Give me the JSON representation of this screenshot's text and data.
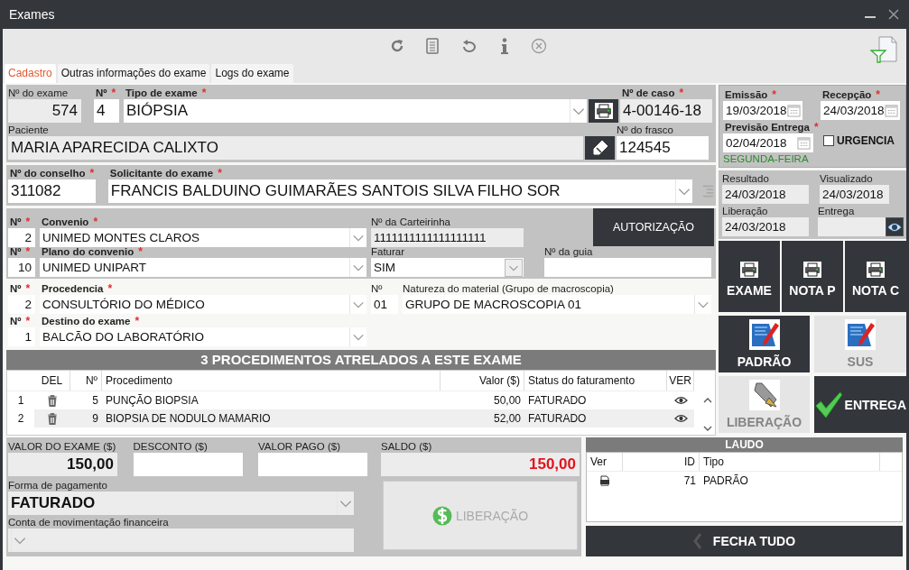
{
  "window": {
    "title": "Exames"
  },
  "tabs": [
    {
      "label": "Cadastro",
      "selected": true
    },
    {
      "label": "Outras informações do exame",
      "selected": false
    },
    {
      "label": "Logs do exame",
      "selected": false
    }
  ],
  "exam": {
    "exam_number": {
      "label": "Nº do exame",
      "value": "574",
      "readonly": true
    },
    "type_number": {
      "label": "Nº",
      "mark": "*",
      "value": "4",
      "readonly": false
    },
    "exam_type": {
      "label": "Tipo de exame",
      "mark": "*",
      "value": "BIÓPSIA",
      "readonly": false
    },
    "case_number": {
      "label": "Nº de caso",
      "mark": "*",
      "value": "4-00146-18",
      "readonly": true
    },
    "patient": {
      "label": "Paciente",
      "value": "MARIA APARECIDA CALIXTO",
      "readonly": true
    },
    "flask_number": {
      "label": "Nº do frasco",
      "value": "124545",
      "readonly": false
    },
    "council_number": {
      "label": "Nº do conselho",
      "mark": "*",
      "value": "311082",
      "readonly": false
    },
    "requester": {
      "label": "Solicitante do exame",
      "mark": "*",
      "value": "FRANCIS BALDUINO GUIMARÃES SANTOIS SILVA FILHO SOR",
      "readonly": false
    }
  },
  "insurance": {
    "insurer_number": {
      "label": "Nº",
      "mark": "*",
      "value": "2",
      "readonly": false
    },
    "insurer": {
      "label": "Convenio",
      "mark": "*",
      "value": "UNIMED MONTES CLAROS",
      "readonly": false
    },
    "card_number": {
      "label": "Nº da Carteirinha",
      "value": "1111111111111111111",
      "readonly": true
    },
    "authorization_button": "AUTORIZAÇÃO",
    "plan_number": {
      "label": "Nº",
      "mark": "*",
      "value": "10",
      "readonly": false
    },
    "plan": {
      "label": "Plano do convenio",
      "mark": "*",
      "value": "UNIMED UNIPART",
      "readonly": false
    },
    "bill": {
      "label": "Faturar",
      "value": "SIM",
      "readonly": false
    },
    "guide_number": {
      "label": "Nº da guia",
      "readonly": false
    }
  },
  "origin": {
    "origin_number": {
      "label": "Nº",
      "mark": "*",
      "value": "2",
      "readonly": false
    },
    "origin": {
      "label": "Procedencia",
      "mark": "*",
      "value": "CONSULTÓRIO DO MÉDICO",
      "readonly": false
    },
    "material_number": {
      "label": "Nº",
      "value": "01",
      "readonly": false
    },
    "material": {
      "label": "Natureza do material (Grupo de macroscopia)",
      "value": "GRUPO DE MACROSCOPIA 01",
      "readonly": false
    },
    "destination_number": {
      "label": "Nº",
      "mark": "*",
      "value": "1",
      "readonly": false
    },
    "destination": {
      "label": "Destino do exame",
      "mark": "*",
      "value": "BALCÃO DO LABORATÓRIO",
      "readonly": false
    }
  },
  "procedures": {
    "title": "3 PROCEDIMENTOS ATRELADOS A ESTE EXAME",
    "columns": [
      "DEL",
      "Nº",
      "Procedimento",
      "Valor ($)",
      "Status do faturamento",
      "VER"
    ],
    "rows": [
      {
        "index": "1",
        "number": "5",
        "procedure": "PUNÇÃO BIOPSIA",
        "value": "50,00",
        "status": "FATURADO"
      },
      {
        "index": "2",
        "number": "9",
        "procedure": "BIOPSIA DE NODULO MAMARIO",
        "value": "52,00",
        "status": "FATURADO"
      }
    ]
  },
  "dates": {
    "issue": {
      "label": "Emissão",
      "mark": "*",
      "value": "19/03/2018",
      "readonly": false
    },
    "reception": {
      "label": "Recepção",
      "mark": "*",
      "value": "24/03/2018",
      "readonly": false
    },
    "forecast": {
      "label": "Previsão Entrega",
      "mark": "*",
      "value": "02/04/2018",
      "readonly": false
    },
    "urgent": {
      "label": "URGENCIA",
      "checked": false
    },
    "weekday": "SEGUNDA-FEIRA"
  },
  "status_dates": {
    "result": {
      "label": "Resultado",
      "value": "24/03/2018",
      "readonly": true
    },
    "viewed": {
      "label": "Visualizado",
      "value": "24/03/2018",
      "readonly": true
    },
    "release": {
      "label": "Liberação",
      "value": "24/03/2018",
      "readonly": true
    },
    "delivery": {
      "label": "Entrega",
      "readonly": true
    }
  },
  "print_buttons": [
    {
      "label": "EXAME"
    },
    {
      "label": "NOTA P"
    },
    {
      "label": "NOTA C"
    }
  ],
  "action_buttons": [
    {
      "label": "PADRÃO",
      "kind": "report",
      "disabled": false
    },
    {
      "label": "SUS",
      "kind": "report",
      "disabled": true
    },
    {
      "label": "LIBERAÇÃO",
      "kind": "pen",
      "disabled": true
    },
    {
      "label": "ENTREGA",
      "kind": "check",
      "disabled": false
    }
  ],
  "payment": {
    "exam_value": {
      "label": "VALOR DO EXAME ($)",
      "value": "150,00",
      "readonly": true
    },
    "discount": {
      "label": "DESCONTO ($)",
      "readonly": false
    },
    "paid": {
      "label": "VALOR PAGO ($)",
      "readonly": false
    },
    "balance": {
      "label": "SALDO ($)",
      "value": "150,00",
      "readonly": true
    },
    "method": {
      "label": "Forma de pagamento",
      "value": "FATURADO",
      "readonly": true
    },
    "account": {
      "label": "Conta de movimentação financeira",
      "readonly": true
    },
    "release_button": {
      "label": "LIBERAÇÃO",
      "disabled": true
    }
  },
  "report": {
    "title": "LAUDO",
    "columns": [
      "Ver",
      "ID",
      "Tipo"
    ],
    "rows": [
      {
        "id": "71",
        "type": "PADRÃO"
      }
    ]
  },
  "close_button": "FECHA TUDO"
}
